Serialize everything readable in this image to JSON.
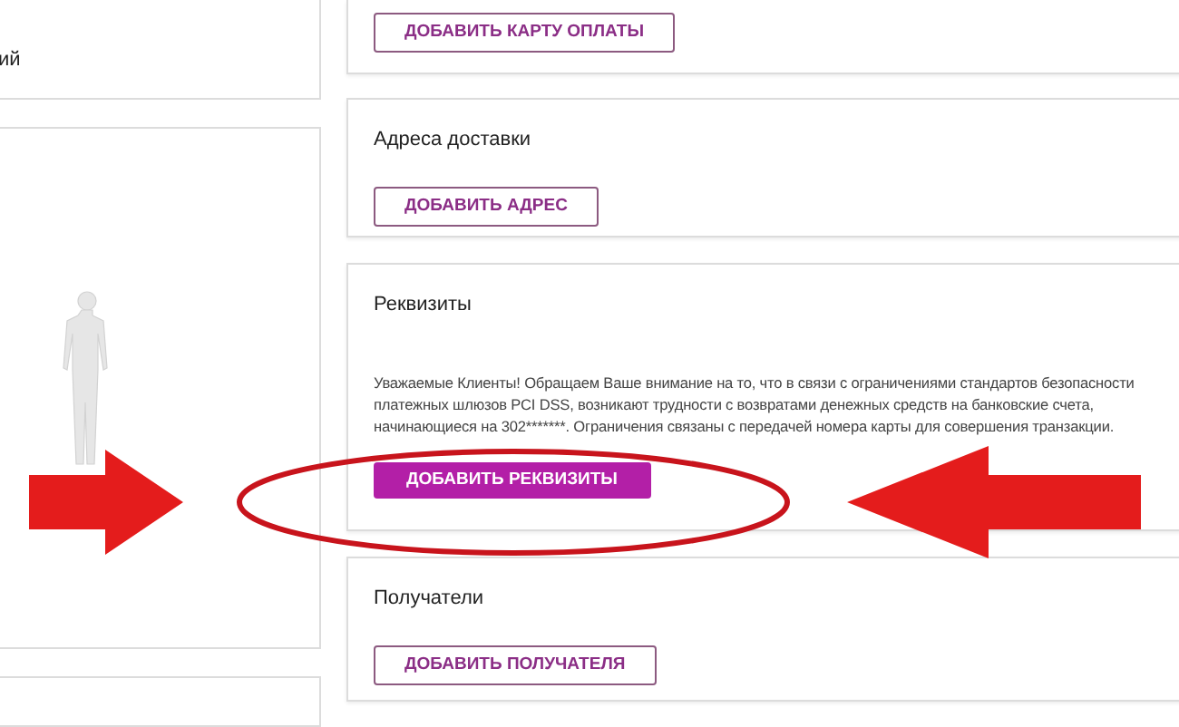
{
  "left_panel": {
    "text": "ий"
  },
  "sections": [
    {
      "button": "ДОБАВИТЬ КАРТУ ОПЛАТЫ",
      "primary": false
    },
    {
      "title": "Адреса доставки",
      "button": "ДОБАВИТЬ АДРЕС",
      "primary": false
    },
    {
      "title": "Реквизиты",
      "notice": "Уважаемые Клиенты! Обращаем Ваше внимание на то, что в связи с ограничениями стандартов безопасности платежных шлюзов PCI DSS, возникают трудности с возвратами денежных средств на банковские счета, начинающиеся на 302*******. Ограничения связаны с передачей номера карты для совершения транзакции.",
      "button": "ДОБАВИТЬ РЕКВИЗИТЫ",
      "primary": true
    },
    {
      "title": "Получатели",
      "button": "ДОБАВИТЬ ПОЛУЧАТЕЛЯ",
      "primary": false
    }
  ]
}
